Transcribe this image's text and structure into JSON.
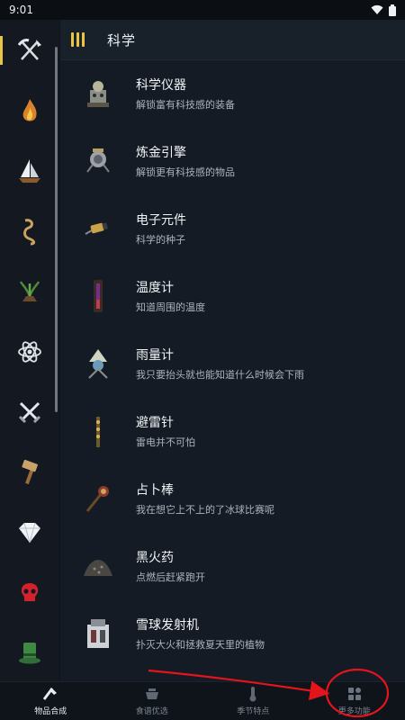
{
  "status": {
    "time": "9:01"
  },
  "sidebar": {
    "items": [
      {
        "icon": "pickaxe-axe-icon",
        "active": true
      },
      {
        "icon": "fire-icon"
      },
      {
        "icon": "sailboat-icon"
      },
      {
        "icon": "rope-icon"
      },
      {
        "icon": "farm-plant-icon"
      },
      {
        "icon": "atom-science-icon"
      },
      {
        "icon": "crossed-swords-icon"
      },
      {
        "icon": "hammer-icon"
      },
      {
        "icon": "diamond-icon"
      },
      {
        "icon": "red-skull-icon"
      },
      {
        "icon": "green-top-hat-icon"
      }
    ]
  },
  "header": {
    "title": "科学"
  },
  "items": [
    {
      "name": "科学仪器",
      "desc": "解锁富有科技感的装备",
      "icon": "science-machine-icon"
    },
    {
      "name": "炼金引擎",
      "desc": "解锁更有科技感的物品",
      "icon": "alchemy-engine-icon"
    },
    {
      "name": "电子元件",
      "desc": "科学的种子",
      "icon": "electrical-doodad-icon"
    },
    {
      "name": "温度计",
      "desc": "知道周围的温度",
      "icon": "thermometer-icon"
    },
    {
      "name": "雨量计",
      "desc": "我只要抬头就也能知道什么时候会下雨",
      "icon": "rainometer-icon"
    },
    {
      "name": "避雷针",
      "desc": "雷电并不可怕",
      "icon": "lightning-rod-icon"
    },
    {
      "name": "占卜棒",
      "desc": "我在想它上不上的了冰球比赛呢",
      "icon": "divining-rod-icon"
    },
    {
      "name": "黑火药",
      "desc": "点燃后赶紧跑开",
      "icon": "gunpowder-icon"
    },
    {
      "name": "雪球发射机",
      "desc": "扑灭大火和拯救夏天里的植物",
      "icon": "ice-flingomatic-icon"
    }
  ],
  "tabs": [
    {
      "label": "物品合成",
      "icon": "crafting-icon",
      "active": true
    },
    {
      "label": "食谱优选",
      "icon": "crockpot-icon"
    },
    {
      "label": "季节特点",
      "icon": "thermometer-tab-icon"
    },
    {
      "label": "更多功能",
      "icon": "more-functions-icon"
    }
  ],
  "colors": {
    "accent": "#e9c546",
    "annotation": "#e3141b"
  }
}
